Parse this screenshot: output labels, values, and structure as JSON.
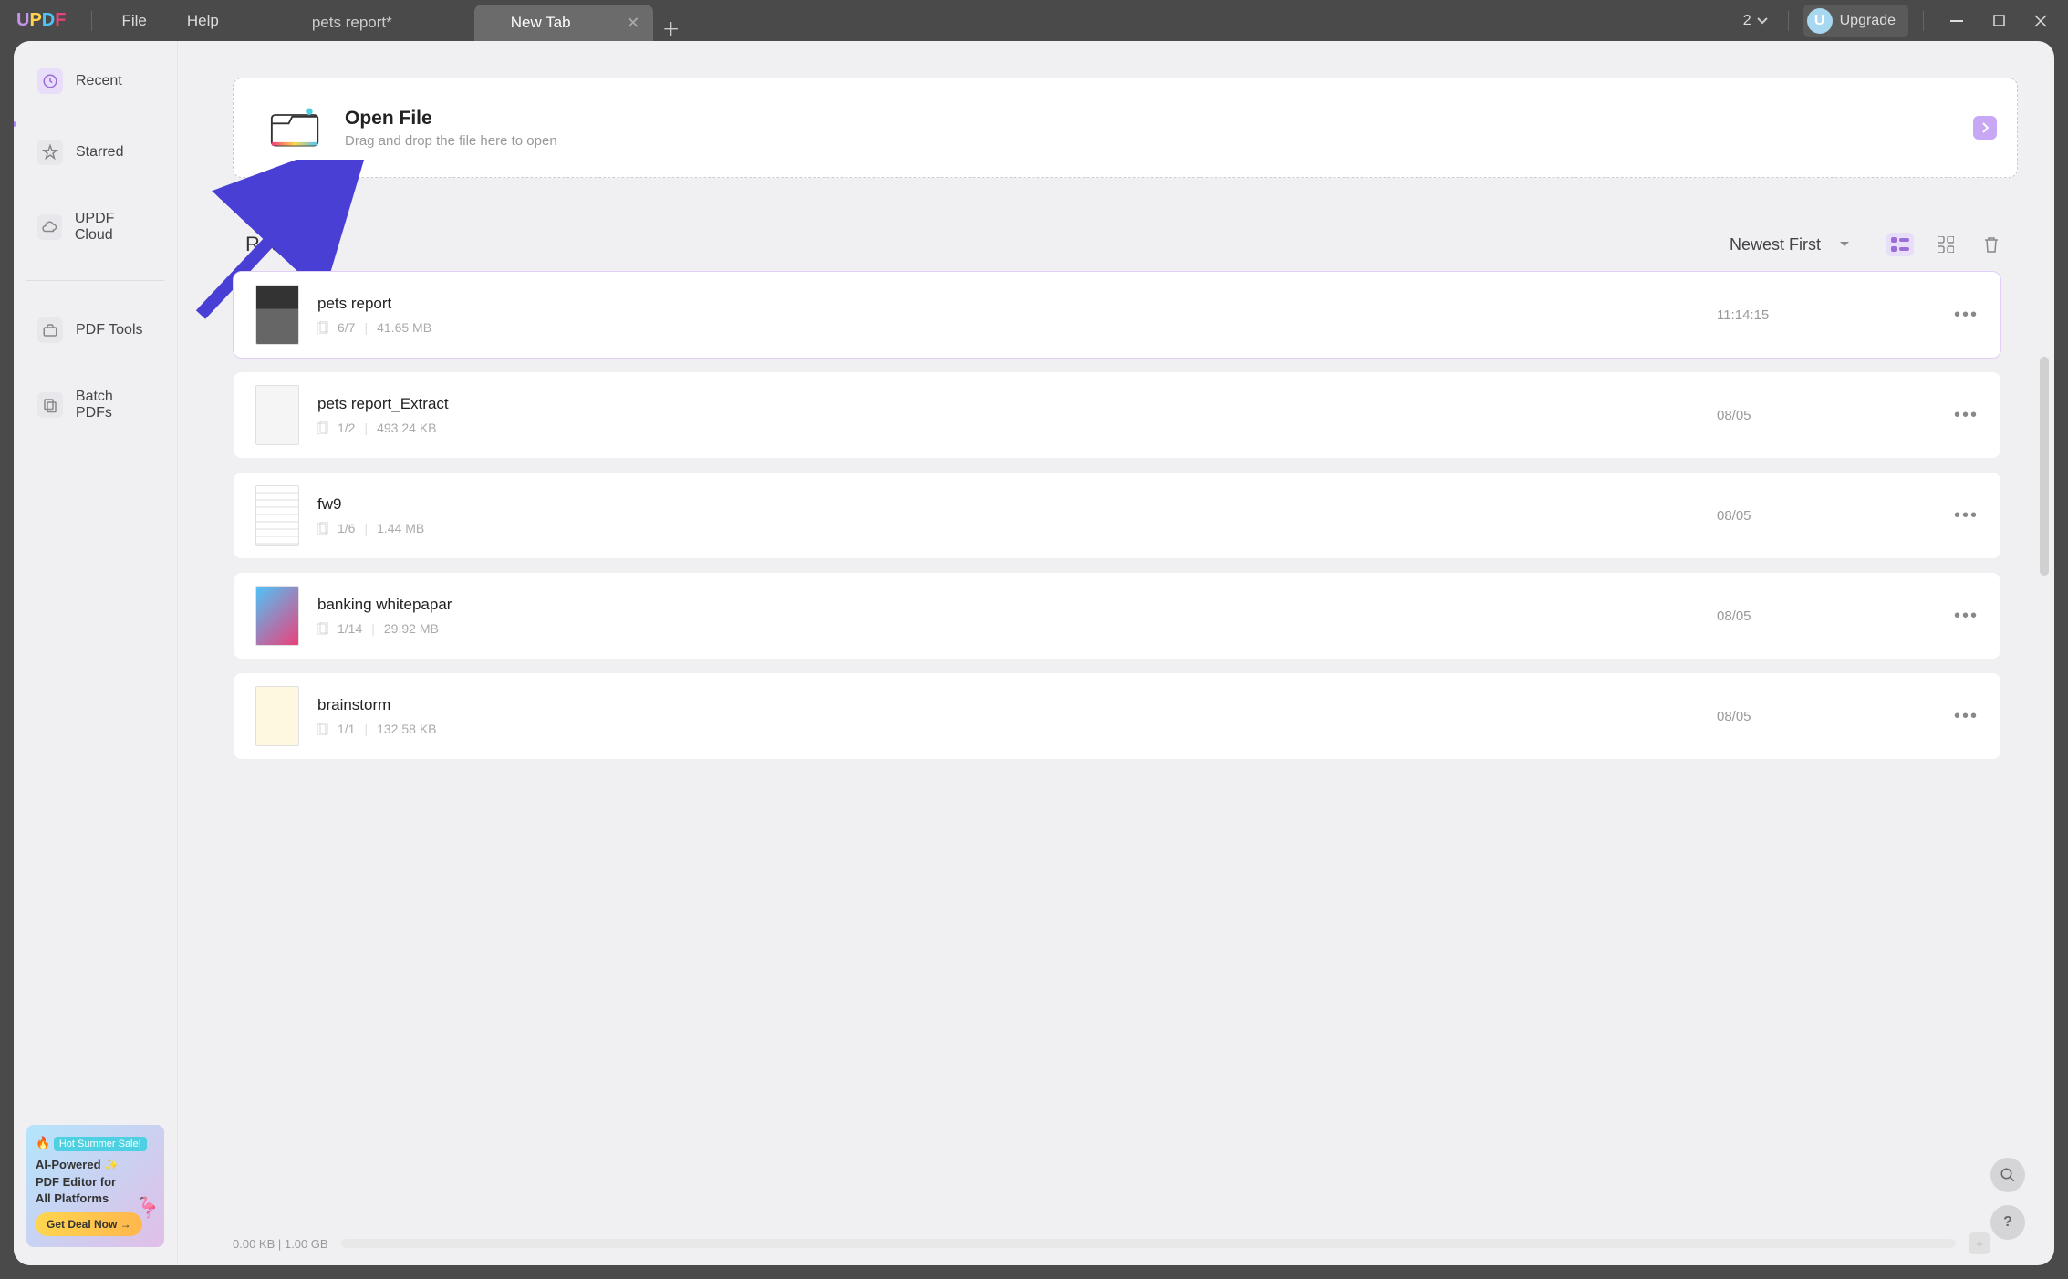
{
  "menu": {
    "file": "File",
    "help": "Help"
  },
  "tabs": {
    "inactive": "pets report*",
    "active": "New Tab"
  },
  "title_right": {
    "count": "2",
    "upgrade": "Upgrade",
    "avatar_initial": "U"
  },
  "sidebar": {
    "recent": "Recent",
    "starred": "Starred",
    "cloud": "UPDF Cloud",
    "tools": "PDF Tools",
    "batch": "Batch PDFs"
  },
  "promo": {
    "badge": "Hot Summer Sale!",
    "line1": "AI-Powered",
    "line2": "PDF Editor for",
    "line3": "All Platforms",
    "button": "Get Deal Now →"
  },
  "open_file": {
    "title": "Open File",
    "subtitle": "Drag and drop the file here to open"
  },
  "recent_section": {
    "title": "Recent",
    "sort": "Newest First"
  },
  "files": [
    {
      "name": "pets report",
      "pages": "6/7",
      "size": "41.65 MB",
      "date": "11:14:15"
    },
    {
      "name": "pets report_Extract",
      "pages": "1/2",
      "size": "493.24 KB",
      "date": "08/05"
    },
    {
      "name": "fw9",
      "pages": "1/6",
      "size": "1.44 MB",
      "date": "08/05"
    },
    {
      "name": "banking whitepapar",
      "pages": "1/14",
      "size": "29.92 MB",
      "date": "08/05"
    },
    {
      "name": "brainstorm",
      "pages": "1/1",
      "size": "132.58 KB",
      "date": "08/05"
    }
  ],
  "storage": {
    "used": "0.00 KB",
    "total": "1.00 GB"
  }
}
